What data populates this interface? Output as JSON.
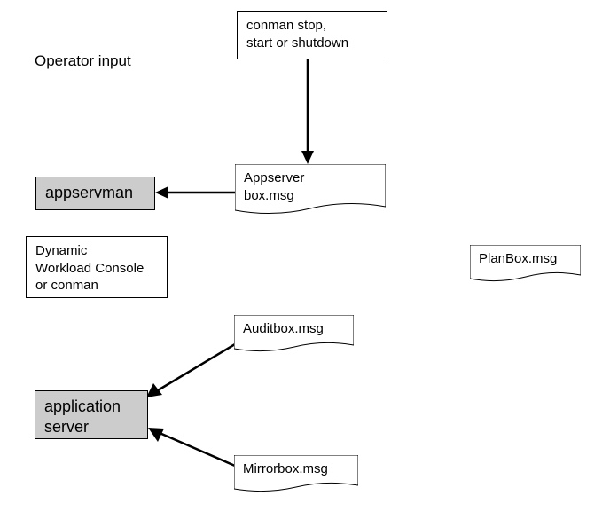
{
  "labels": {
    "operator_input": "Operator input"
  },
  "boxes": {
    "conman": "conman stop,\nstart or shutdown",
    "appservman": "appservman",
    "dynamic_console": "Dynamic\nWorkload Console\nor conman",
    "application_server": "application\nserver"
  },
  "msg_boxes": {
    "appserver_box": "Appserver\nbox.msg",
    "planbox": "PlanBox.msg",
    "auditbox": "Auditbox.msg",
    "mirrorbox": "Mirrorbox.msg"
  },
  "chart_data": {
    "type": "diagram",
    "nodes": [
      {
        "id": "operator_input",
        "type": "label",
        "text": "Operator input"
      },
      {
        "id": "conman",
        "type": "box",
        "text": "conman stop, start or shutdown"
      },
      {
        "id": "appserver_box",
        "type": "msg",
        "text": "Appserver box.msg"
      },
      {
        "id": "appservman",
        "type": "shaded-box",
        "text": "appservman"
      },
      {
        "id": "dynamic_console",
        "type": "box",
        "text": "Dynamic Workload Console or conman"
      },
      {
        "id": "planbox",
        "type": "msg",
        "text": "PlanBox.msg"
      },
      {
        "id": "auditbox",
        "type": "msg",
        "text": "Auditbox.msg"
      },
      {
        "id": "application_server",
        "type": "shaded-box",
        "text": "application server"
      },
      {
        "id": "mirrorbox",
        "type": "msg",
        "text": "Mirrorbox.msg"
      }
    ],
    "edges": [
      {
        "from": "conman",
        "to": "appserver_box"
      },
      {
        "from": "appserver_box",
        "to": "appservman"
      },
      {
        "from": "auditbox",
        "to": "application_server"
      },
      {
        "from": "mirrorbox",
        "to": "application_server"
      }
    ]
  }
}
